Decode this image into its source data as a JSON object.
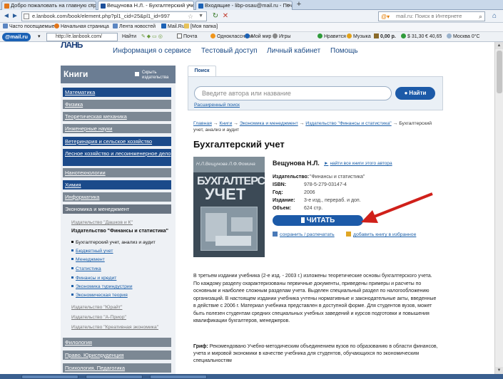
{
  "browser": {
    "tabs": [
      {
        "label": "Добро пожаловать на главную страницу",
        "active": false,
        "color": "#e2761a"
      },
      {
        "label": "Вещунова Н.Л. - Бухгалтерский учет | ...",
        "active": true,
        "color": "#1c4f9a"
      },
      {
        "label": "Входящие - libp-osau@mail.ru - Почта Ма...",
        "active": false,
        "color": "#1c62b5"
      }
    ],
    "new_tab": "+",
    "url": "e.lanbook.com/book/element.php?pl1_cid=25&pl1_id=997",
    "search_placeholder": "mail.ru: Поиск в Интернете",
    "bookmarks": [
      "Часто посещаемые",
      "Начальная страница",
      "Лента новостей",
      "Mail.Ru",
      "[Моя папка]"
    ],
    "mailru": {
      "logo_main": "@mail.ru",
      "logo_dot": ".",
      "input_value": "http://e.lanbook.com/",
      "find": "Найти",
      "items": [
        "Почта",
        "Одноклассники",
        "Мой мир",
        "Игры",
        "Нравится",
        "Музыка",
        "0,00 р.",
        "$ 31,30",
        "€ 40,65",
        "Москва 0°C"
      ]
    }
  },
  "site": {
    "logo": "ЛАНЬ",
    "nav": [
      "Информация о сервисе",
      "Тестовый доступ",
      "Личный кабинет",
      "Помощь"
    ]
  },
  "sidebar": {
    "title": "Книги",
    "hide_label": "Скрыть издательства",
    "categories_top": [
      {
        "label": "Математика",
        "style": "blue"
      },
      {
        "label": "Физика",
        "style": "gray"
      },
      {
        "label": "Теоретическая механика",
        "style": "gray"
      },
      {
        "label": "Инженерные науки",
        "style": "gray"
      },
      {
        "label": "Ветеринария и сельское хозяйство",
        "style": "blue"
      },
      {
        "label": "Лесное хозяйство и лесоинженерное дело",
        "style": "blue"
      },
      {
        "label": "Нанотехнологии",
        "style": "gray"
      },
      {
        "label": "Химия",
        "style": "blue"
      },
      {
        "label": "Информатика",
        "style": "gray"
      },
      {
        "label": "Экономика и менеджмент",
        "style": "sel"
      }
    ],
    "publishers_before": "Издательство \"Дашков и К\"",
    "current_publisher": "Издательство \"Финансы и статистика\"",
    "books": [
      "Бухгалтерский учет, анализ и аудит",
      "Бюджетный учет",
      "Менеджмент",
      "Статистика",
      "Финансы и кредит",
      "Экономика туриндустрии",
      "Экономическая теория"
    ],
    "publishers_after": [
      "Издательство \"Юрайт\"",
      "Издательство \"А-Приор\"",
      "Издательство \"Креативная экономика\""
    ],
    "categories_bottom": [
      {
        "label": "Филология",
        "style": "gray"
      },
      {
        "label": "Право. Юриспруденция",
        "style": "gray"
      },
      {
        "label": "Психология. Педагогика",
        "style": "gray"
      }
    ]
  },
  "search": {
    "tab": "Поиск",
    "placeholder": "Введите автора или название",
    "button": "Найти",
    "advanced": "Расширенный поиск"
  },
  "breadcrumbs": {
    "items": [
      "Главная",
      "Книги",
      "Экономика и менеджмент",
      "Издательство \"Финансы и статистика\""
    ],
    "current": "Бухгалтерский учет, анализ и аудит"
  },
  "book": {
    "title": "Бухгалтерский учет",
    "author": "Вещунова Н.Л.",
    "all_books": "найти все книги этого автора",
    "cover": {
      "authors": "Н.Л.Вещунова  Л.Ф.Фомина",
      "title1": "БУХГАЛТЕРСКИЙ",
      "title2": "УЧЕТ"
    },
    "meta": [
      {
        "label": "Издательство:",
        "value": "\"Финансы и статистика\""
      },
      {
        "label": "ISBN:",
        "value": "978-5-279-03147-4"
      },
      {
        "label": "Год:",
        "value": "2006"
      },
      {
        "label": "Издание:",
        "value": "3-е изд., перераб. и доп."
      },
      {
        "label": "Объем:",
        "value": "624 стр."
      }
    ],
    "read_button": "ЧИТАТЬ",
    "save_link": "сохранить / распечатать",
    "fav_link": "добавить книгу в избранное",
    "description": "В третьем издании учебника (2-е изд. - 2003 г.) изложены теоретические основы бухгалтерского учета. По каждому разделу охарактеризованы первичные документы, приведены примеры и расчеты по основным и наиболее сложным разделам учета. Выделен специальный раздел по налогообложению организаций. В настоящем издании учебника учтены нормативные и законодательные акты, введенные в действие с 2006 г. Материал учебника представлен в доступной форме. Для студентов вузов, может быть полезен студентам средних специальных учебных заведений и курсов подготовки и повышения квалификации бухгалтеров, менеджеров.",
    "grif_label": "Гриф:",
    "grif_text": "Рекомендовано Учебно-методическим объединением вузов по образованию в области финансов, учета и мировой экономики в качестве учебника для студентов, обучающихся по экономическим специальностям"
  },
  "colors": {
    "brand_blue": "#1c5aa8",
    "sidebar_blue": "#1b4a8a",
    "sidebar_gray": "#7c8894",
    "arrow_red": "#d0201a"
  }
}
